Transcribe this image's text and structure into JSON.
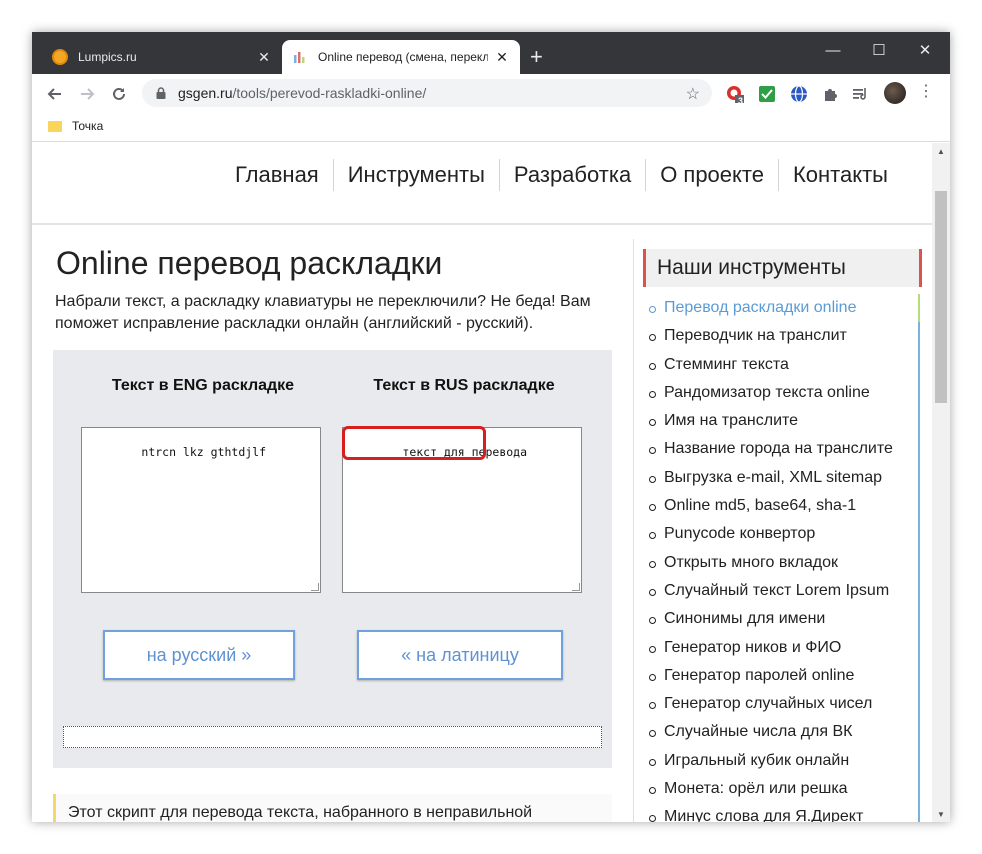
{
  "browser": {
    "tabs": [
      {
        "title": "Lumpics.ru",
        "active": false
      },
      {
        "title": "Online перевод (смена, перекл",
        "active": true
      }
    ],
    "url_host": "gsgen.ru",
    "url_path": "/tools/perevod-raskladki-online/",
    "extension_badge": "3",
    "bookmarks": [
      {
        "label": "Точка"
      }
    ],
    "controls": {
      "minimize": "—",
      "maximize": "☐",
      "close": "✕",
      "new_tab": "+"
    }
  },
  "site_nav": {
    "items": [
      "Главная",
      "Инструменты",
      "Разработка",
      "О проекте",
      "Контакты"
    ]
  },
  "main": {
    "title": "Online перевод раскладки",
    "intro": "Набрали текст, а раскладку клавиатуры не переключили? Не беда! Вам поможет исправление раскладки онлайн (английский - русский).",
    "eng_heading": "Текст в ENG раскладке",
    "rus_heading": "Текст в RUS раскладке",
    "eng_text": "ntrcn lkz gthtdjlf",
    "rus_text": "текст для перевода",
    "to_russian_button": "на русский »",
    "to_latin_button": "« на латиницу",
    "note_text": "Этот скрипт для перевода текста, набранного в неправильной"
  },
  "sidebar": {
    "heading": "Наши инструменты",
    "tools": [
      "Перевод раскладки online",
      "Переводчик на транслит",
      "Стемминг текста",
      "Рандомизатор текста online",
      "Имя на транслите",
      "Название города на транслите",
      "Выгрузка e-mail, XML sitemap",
      "Online md5, base64, sha-1",
      "Punycode конвертор",
      "Открыть много вкладок",
      "Случайный текст Lorem Ipsum",
      "Синонимы для имени",
      "Генератор ников и ФИО",
      "Генератор паролей online",
      "Генератор случайных чисел",
      "Случайные числа для ВК",
      "Игральный кубик онлайн",
      "Монета: орёл или решка",
      "Минус слова для Я.Директ"
    ],
    "active_index": 0
  },
  "colors": {
    "accent_blue": "#5b9bd5",
    "highlight_red": "#d71f1f",
    "tab_strip": "#35363a"
  }
}
